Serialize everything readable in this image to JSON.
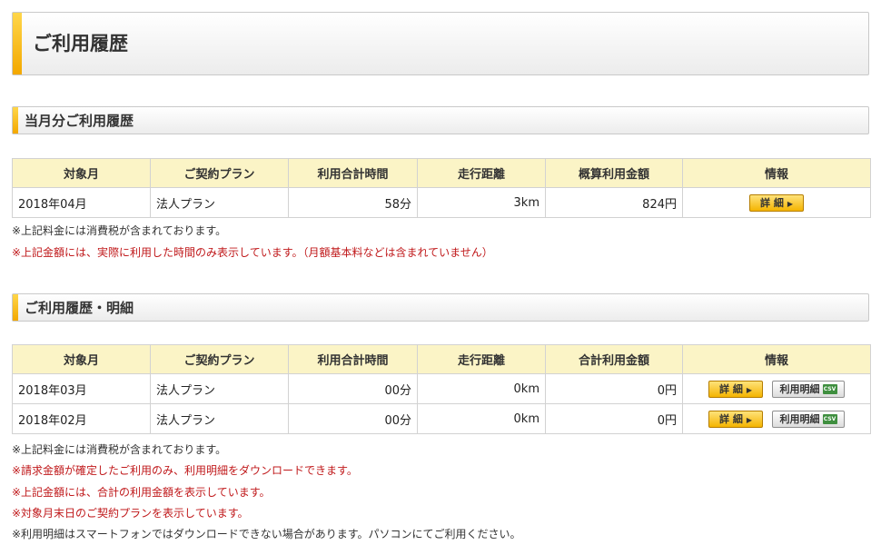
{
  "page": {
    "title": "ご利用履歴"
  },
  "current": {
    "section_title": "当月分ご利用履歴",
    "columns": [
      "対象月",
      "ご契約プラン",
      "利用合計時間",
      "走行距離",
      "概算利用金額",
      "情報"
    ],
    "rows": [
      {
        "month": "2018年04月",
        "plan": "法人プラン",
        "time": "58分",
        "distance": "3km",
        "amount": "824円"
      }
    ],
    "notes": [
      "※上記料金には消費税が含まれております。",
      "※上記金額には、実際に利用した時間のみ表示しています。（月額基本料などは含まれていません）"
    ]
  },
  "history": {
    "section_title": "ご利用履歴・明細",
    "columns": [
      "対象月",
      "ご契約プラン",
      "利用合計時間",
      "走行距離",
      "合計利用金額",
      "情報"
    ],
    "rows": [
      {
        "month": "2018年03月",
        "plan": "法人プラン",
        "time": "00分",
        "distance": "0km",
        "amount": "0円"
      },
      {
        "month": "2018年02月",
        "plan": "法人プラン",
        "time": "00分",
        "distance": "0km",
        "amount": "0円"
      }
    ],
    "notes": [
      "※上記料金には消費税が含まれております。",
      "※請求金額が確定したご利用のみ、利用明細をダウンロードできます。",
      "※上記金額には、合計の利用金額を表示しています。",
      "※対象月末日のご契約プランを表示しています。",
      "※利用明細はスマートフォンではダウンロードできない場合があります。パソコンにてご利用ください。"
    ]
  },
  "buttons": {
    "detail": "詳 細",
    "detail_arrow": "▶",
    "statement": "利用明細",
    "csv_icon_text": "CSV"
  },
  "colors": {
    "accent": "#f3a800",
    "header_bg": "#fbf4c6",
    "note_red": "#c0191b"
  }
}
